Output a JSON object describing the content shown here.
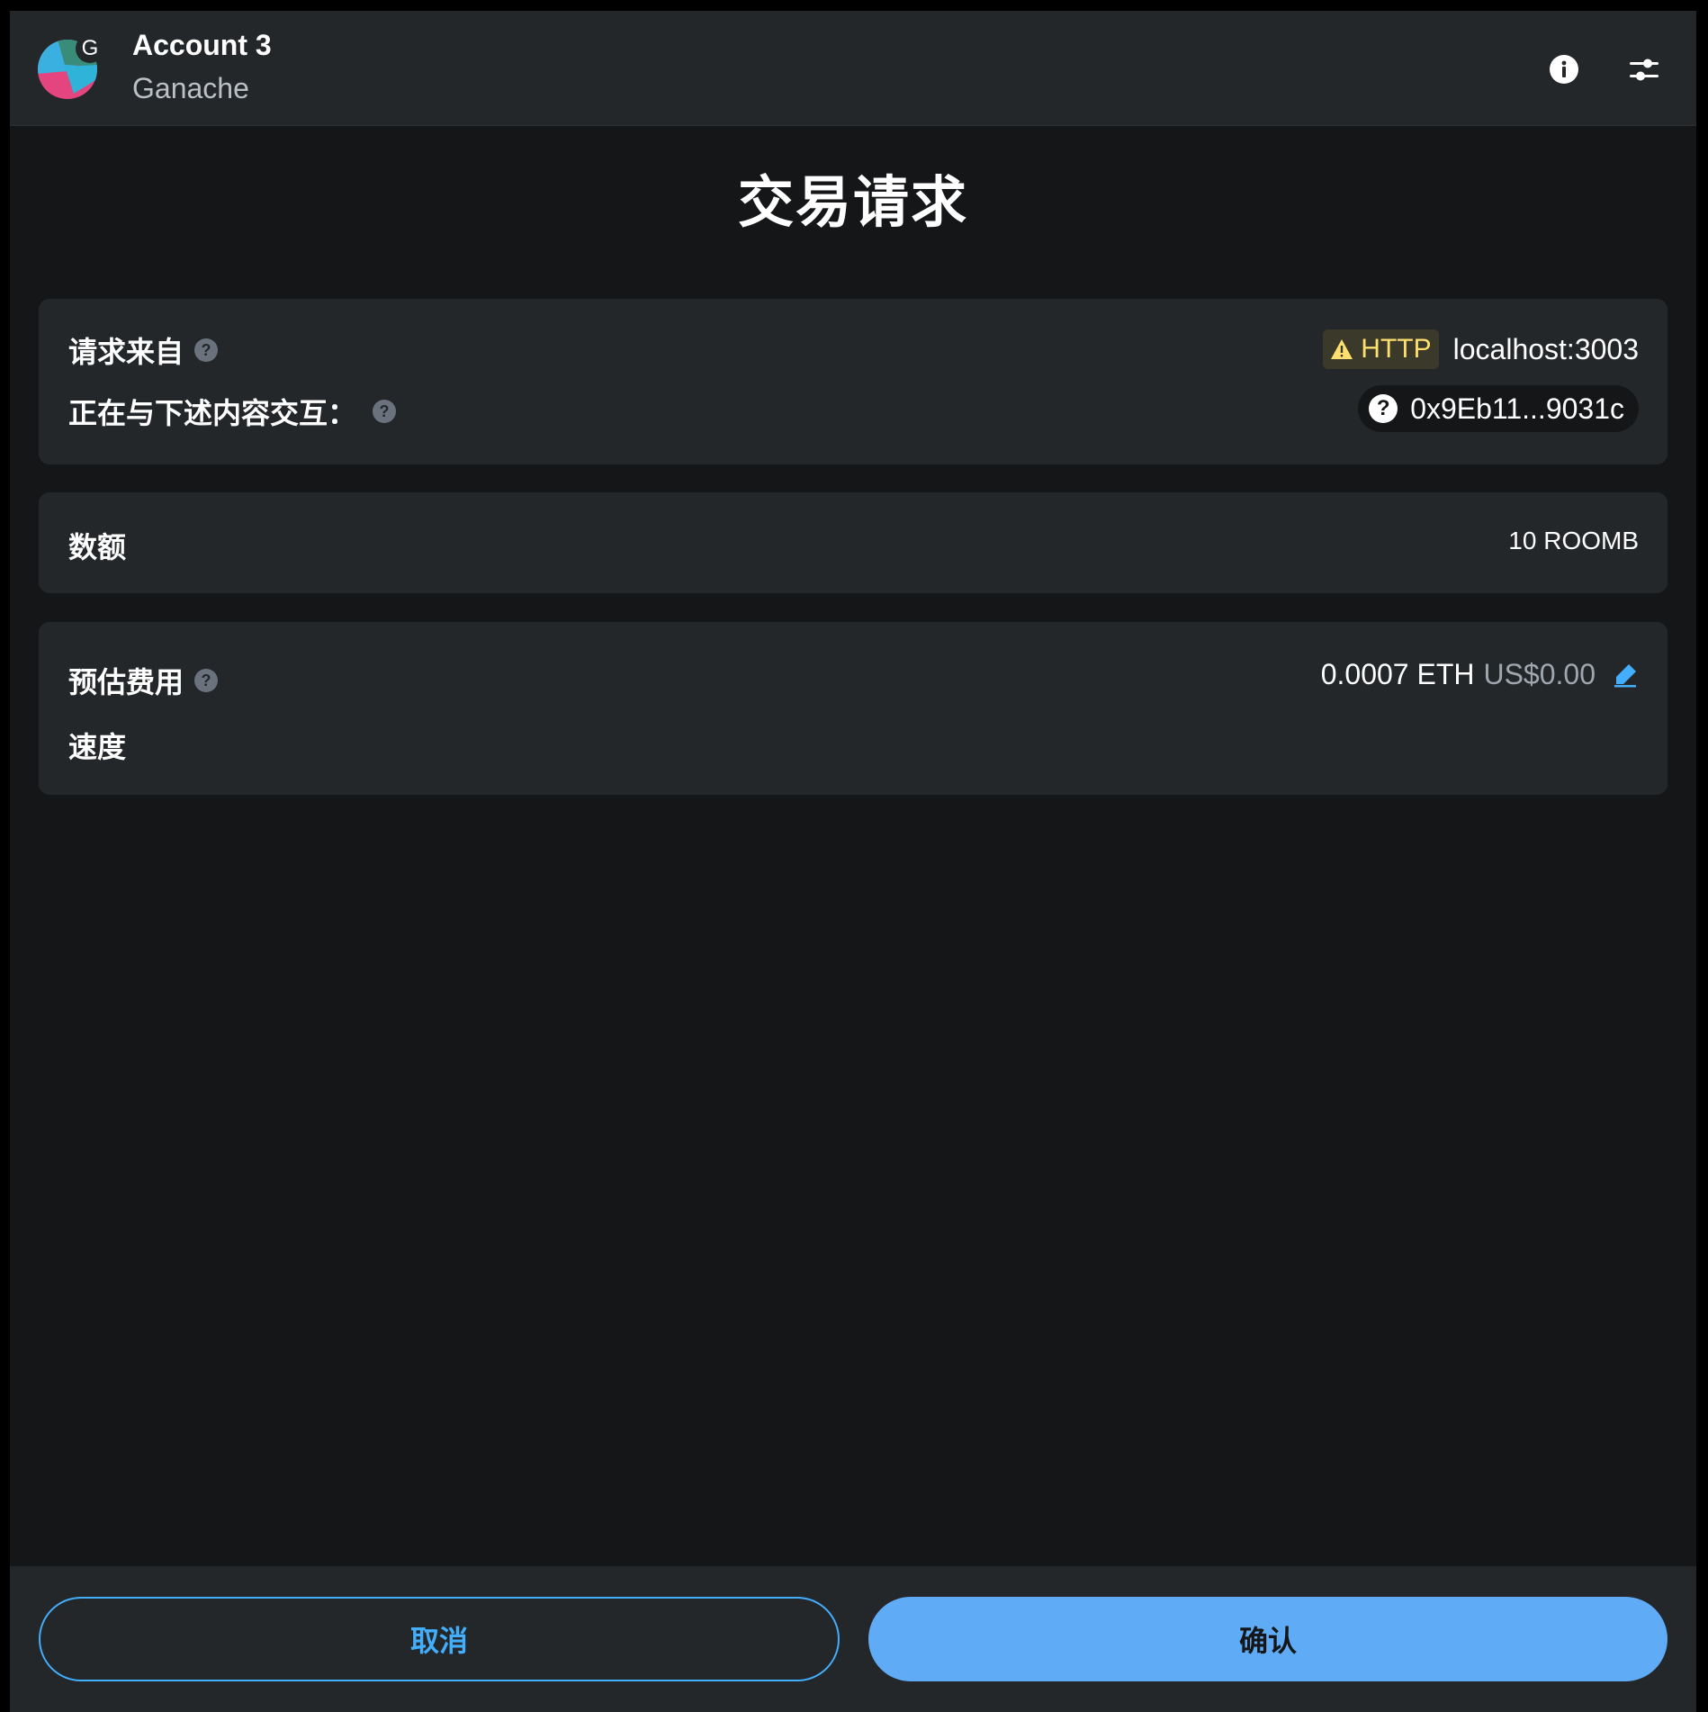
{
  "header": {
    "account_name": "Account 3",
    "network_name": "Ganache",
    "avatar_badge": "G",
    "info_icon": "info-icon",
    "settings_icon": "sliders-icon"
  },
  "title": "交易请求",
  "request_card": {
    "origin_label": "请求来自",
    "http_badge": "HTTP",
    "origin_value": "localhost:3003",
    "interacting_label": "正在与下述内容交互：",
    "contract_address": "0x9Eb11...9031c",
    "help_glyph": "?"
  },
  "amount_card": {
    "label": "数额",
    "value": "10 ROOMB"
  },
  "fee_card": {
    "label": "预估费用",
    "eth_value": "0.0007 ETH",
    "usd_value": "US$0.00",
    "speed_label": "速度",
    "edit_icon": "pencil-icon"
  },
  "footer": {
    "cancel_label": "取消",
    "confirm_label": "确认"
  },
  "colors": {
    "background": "#141618",
    "card": "#24272a",
    "accent": "#43aefc",
    "confirm_fill": "#5fabf5",
    "warning": "#ffdf70"
  }
}
